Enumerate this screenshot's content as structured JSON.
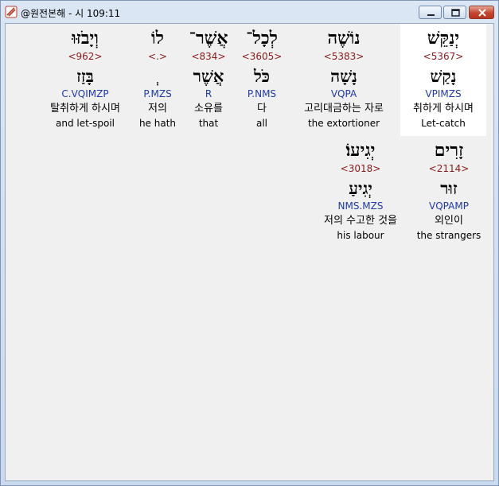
{
  "window": {
    "title": "@원전본해 - 시 109:11",
    "icon": "app-logo-icon",
    "buttons": [
      "minimize-icon",
      "maximize-icon",
      "close-icon"
    ]
  },
  "words": [
    {
      "hebrew": "יְנַקֵּשׁ",
      "strong": "<5367>",
      "lexeme": "נָקַשׁ",
      "morph": "VPIMZS",
      "korean": "취하게 하시며",
      "english": "Let-catch",
      "selected": true
    },
    {
      "hebrew": "נוֹשֶׁה",
      "strong": "<5383>",
      "lexeme": "נָשָׁה",
      "morph": "VQPA",
      "korean": "고리대금하는 자로",
      "english": "the extortioner"
    },
    {
      "hebrew": "לְכָל־",
      "strong": "<3605>",
      "lexeme": "כֹּל",
      "morph": "P.NMS",
      "korean": "다",
      "english": "all"
    },
    {
      "hebrew": "אֲשֶׁר־",
      "strong": "<834>",
      "lexeme": "אֲשֶׁר",
      "morph": "R",
      "korean": "소유를",
      "english": "that"
    },
    {
      "hebrew": "לוֹ",
      "strong": "<.>",
      "lexeme": "ְ",
      "morph": "P.MZS",
      "korean": "저의",
      "english": "he hath"
    },
    {
      "hebrew": "וְיָבֹזּוּ",
      "strong": "<962>",
      "lexeme": "בָּזַז",
      "morph": "C.VQIMZP",
      "korean": "탈취하게 하시며",
      "english": "and let-spoil"
    },
    {
      "hebrew": "זָרִים",
      "strong": "<2114>",
      "lexeme": "זוּר",
      "morph": "VQPAMP",
      "korean": "외인이",
      "english": "the strangers"
    },
    {
      "hebrew": "יְגִיעוֹ׃",
      "strong": "<3018>",
      "lexeme": "יְגִיעַ",
      "morph": "NMS.MZS",
      "korean": "저의 수고한 것을",
      "english": "his labour"
    }
  ]
}
